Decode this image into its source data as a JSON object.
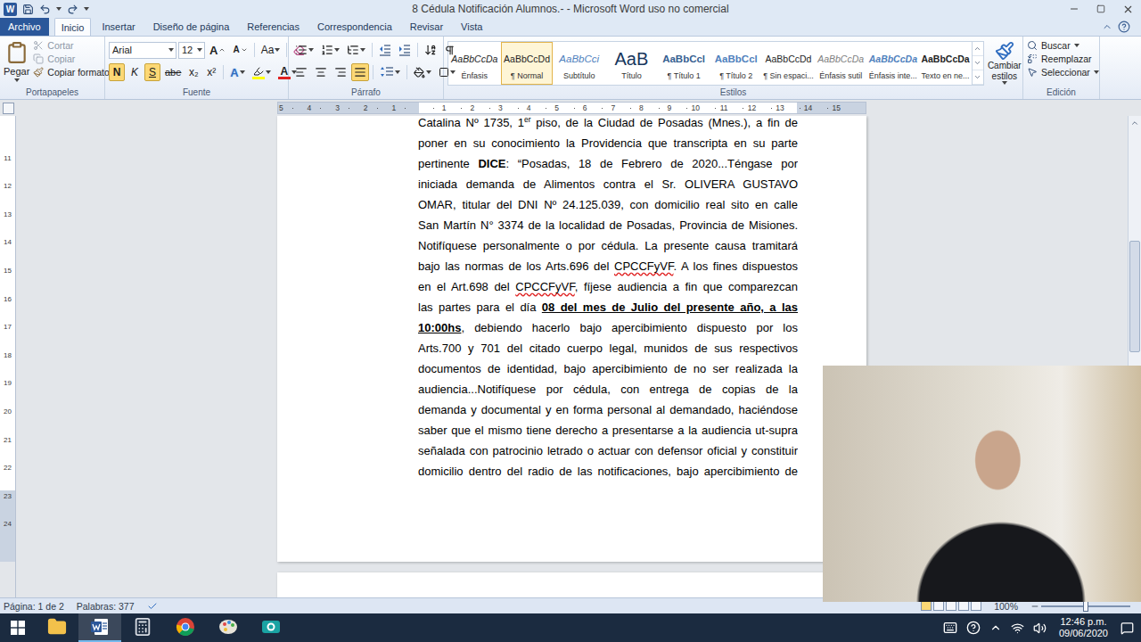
{
  "window": {
    "title": "8 Cédula Notificación Alumnos.- - Microsoft Word uso no comercial",
    "logo": "W"
  },
  "ribbon": {
    "tabs": [
      {
        "label": "Archivo",
        "kind": "file",
        "selected": false
      },
      {
        "label": "Inicio",
        "kind": "tab",
        "selected": true
      },
      {
        "label": "Insertar",
        "kind": "tab",
        "selected": false
      },
      {
        "label": "Diseño de página",
        "kind": "tab",
        "selected": false
      },
      {
        "label": "Referencias",
        "kind": "tab",
        "selected": false
      },
      {
        "label": "Correspondencia",
        "kind": "tab",
        "selected": false
      },
      {
        "label": "Revisar",
        "kind": "tab",
        "selected": false
      },
      {
        "label": "Vista",
        "kind": "tab",
        "selected": false
      }
    ],
    "clipboard": {
      "label": "Portapapeles",
      "paste": "Pegar",
      "items": [
        {
          "label": "Cortar",
          "kind": "cut",
          "disabled": true
        },
        {
          "label": "Copiar",
          "kind": "copy",
          "disabled": true
        },
        {
          "label": "Copiar formato",
          "kind": "format",
          "disabled": false
        }
      ]
    },
    "font": {
      "label": "Fuente",
      "name": "Arial",
      "size": "12",
      "grow": "A",
      "shrink": "A",
      "case": "Aa",
      "effects": "A",
      "color_label": "A",
      "buttons": [
        {
          "label": "N",
          "kind": "bold",
          "selected": true
        },
        {
          "label": "K",
          "kind": "italic",
          "selected": false
        },
        {
          "label": "S",
          "kind": "underline",
          "selected": true
        },
        {
          "label": "abe",
          "kind": "strike",
          "selected": false
        },
        {
          "label": "x₂",
          "kind": "plain",
          "selected": false
        },
        {
          "label": "x²",
          "kind": "plain",
          "selected": false
        }
      ]
    },
    "paragraph": {
      "label": "Párrafo",
      "align": [
        {
          "kind": "left",
          "selected": false
        },
        {
          "kind": "center",
          "selected": false
        },
        {
          "kind": "right",
          "selected": false
        },
        {
          "kind": "justify",
          "selected": true
        }
      ]
    },
    "styles": {
      "label": "Estilos",
      "change": "Cambiar estilos",
      "items": [
        {
          "preview": "AaBbCcDa",
          "label": "Énfasis",
          "kind": "emphasis",
          "selected": false
        },
        {
          "preview": "AaBbCcDd",
          "label": "¶ Normal",
          "kind": "normal",
          "selected": true
        },
        {
          "preview": "AaBbCci",
          "label": "Subtítulo",
          "kind": "subtitle",
          "selected": false
        },
        {
          "preview": "AaB",
          "label": "Título",
          "kind": "title",
          "selected": false
        },
        {
          "preview": "AaBbCcl",
          "label": "¶ Título 1",
          "kind": "heading1",
          "selected": false
        },
        {
          "preview": "AaBbCcl",
          "label": "¶ Título 2",
          "kind": "heading2",
          "selected": false
        },
        {
          "preview": "AaBbCcDd",
          "label": "¶ Sin espaci...",
          "kind": "normal",
          "selected": false
        },
        {
          "preview": "AaBbCcDa",
          "label": "Énfasis sutil",
          "kind": "subtle",
          "selected": false
        },
        {
          "preview": "AaBbCcDa",
          "label": "Énfasis inte...",
          "kind": "intense",
          "selected": false
        },
        {
          "preview": "AaBbCcDa",
          "label": "Texto en ne...",
          "kind": "strong",
          "selected": false
        }
      ]
    },
    "editing": {
      "label": "Edición",
      "items": [
        {
          "label": "Buscar",
          "kind": "find"
        },
        {
          "label": "Reemplazar",
          "kind": "replace"
        },
        {
          "label": "Seleccionar",
          "kind": "select"
        }
      ]
    }
  },
  "ruler": {
    "left": [
      "5",
      "4",
      "3",
      "2",
      "1"
    ],
    "right": [
      "1",
      "2",
      "3",
      "4",
      "5",
      "6",
      "7",
      "8",
      "9",
      "10",
      "11",
      "12",
      "13",
      "14",
      "15"
    ],
    "vertical": [
      "11",
      "12",
      "13",
      "14",
      "15",
      "16",
      "17",
      "18",
      "19",
      "20",
      "21",
      "22",
      "23",
      "24"
    ]
  },
  "document": {
    "lines": [
      {
        "segments": [
          {
            "text": "Catalina Nº 1735, 1",
            "kind": "plain"
          },
          {
            "text": "er",
            "kind": "sup"
          },
          {
            "text": " piso, de la Ciudad de Posadas (Mnes.), a fin de",
            "kind": "plain"
          }
        ]
      },
      {
        "segments": [
          {
            "text": "poner en su conocimiento la Providencia que transcripta en su parte",
            "kind": "plain"
          }
        ]
      },
      {
        "segments": [
          {
            "text": "pertinente ",
            "kind": "plain"
          },
          {
            "text": "DICE",
            "kind": "bold"
          },
          {
            "text": ": “Posadas, 18 de Febrero de 2020...Téngase por",
            "kind": "plain"
          }
        ]
      },
      {
        "segments": [
          {
            "text": "iniciada demanda de Alimentos contra el Sr. OLIVERA GUSTAVO",
            "kind": "plain"
          }
        ]
      },
      {
        "segments": [
          {
            "text": "OMAR, titular del DNI Nº 24.125.039, con domicilio real sito en calle",
            "kind": "plain"
          }
        ]
      },
      {
        "segments": [
          {
            "text": "San Martín N° 3374 de la localidad de Posadas, Provincia de Misiones.",
            "kind": "plain"
          }
        ]
      },
      {
        "segments": [
          {
            "text": "Notifíquese personalmente o por cédula. La presente causa tramitará",
            "kind": "plain"
          }
        ]
      },
      {
        "segments": [
          {
            "text": "bajo las normas de los Arts.696 del ",
            "kind": "plain"
          },
          {
            "text": "CPCCFyVF",
            "kind": "spell"
          },
          {
            "text": ". A los fines dispuestos",
            "kind": "plain"
          }
        ]
      },
      {
        "segments": [
          {
            "text": "en el Art.698 del ",
            "kind": "plain"
          },
          {
            "text": "CPCCFyVF",
            "kind": "spell"
          },
          {
            "text": ", fíjese audiencia a fin que comparezcan",
            "kind": "plain"
          }
        ]
      },
      {
        "segments": [
          {
            "text": "las partes para el día ",
            "kind": "plain"
          },
          {
            "text": "08 del mes de Julio del presente año, a las",
            "kind": "bold_underline"
          }
        ]
      },
      {
        "segments": [
          {
            "text": "10:00hs",
            "kind": "bold_underline"
          },
          {
            "text": ", debiendo hacerlo bajo apercibimiento dispuesto por los",
            "kind": "plain"
          }
        ]
      },
      {
        "segments": [
          {
            "text": "Arts.700 y 701 del citado cuerpo legal, munidos de sus respectivos",
            "kind": "plain"
          }
        ]
      },
      {
        "segments": [
          {
            "text": "documentos de identidad, bajo apercibimiento de no ser realizada la",
            "kind": "plain"
          }
        ]
      },
      {
        "segments": [
          {
            "text": "audiencia...Notifíquese por cédula, con entrega de copias de la",
            "kind": "plain"
          }
        ]
      },
      {
        "segments": [
          {
            "text": "demanda y documental y en forma personal al demandado, haciéndose",
            "kind": "plain"
          }
        ]
      },
      {
        "segments": [
          {
            "text": "saber que el mismo tiene derecho a presentarse a la audiencia ut-supra",
            "kind": "plain"
          }
        ]
      },
      {
        "segments": [
          {
            "text": "señalada con patrocinio letrado o actuar con defensor oficial y constituir",
            "kind": "plain"
          }
        ]
      },
      {
        "segments": [
          {
            "text": "domicilio dentro del radio de las notificaciones, bajo apercibimiento de",
            "kind": "plain"
          }
        ]
      }
    ]
  },
  "status_bar": {
    "page": "Página: 1 de 2",
    "words": "Palabras: 377",
    "zoom": {
      "reading": "100%",
      "level": 0.5
    }
  },
  "taskbar": {
    "apps": [
      {
        "kind": "explorer",
        "selected": false
      },
      {
        "kind": "word",
        "selected": true
      },
      {
        "kind": "calculator",
        "selected": false
      },
      {
        "kind": "chrome",
        "selected": false
      },
      {
        "kind": "paint",
        "selected": false
      },
      {
        "kind": "camera",
        "selected": false
      }
    ],
    "time": "12:46 p.m.",
    "date": "09/06/2020"
  }
}
